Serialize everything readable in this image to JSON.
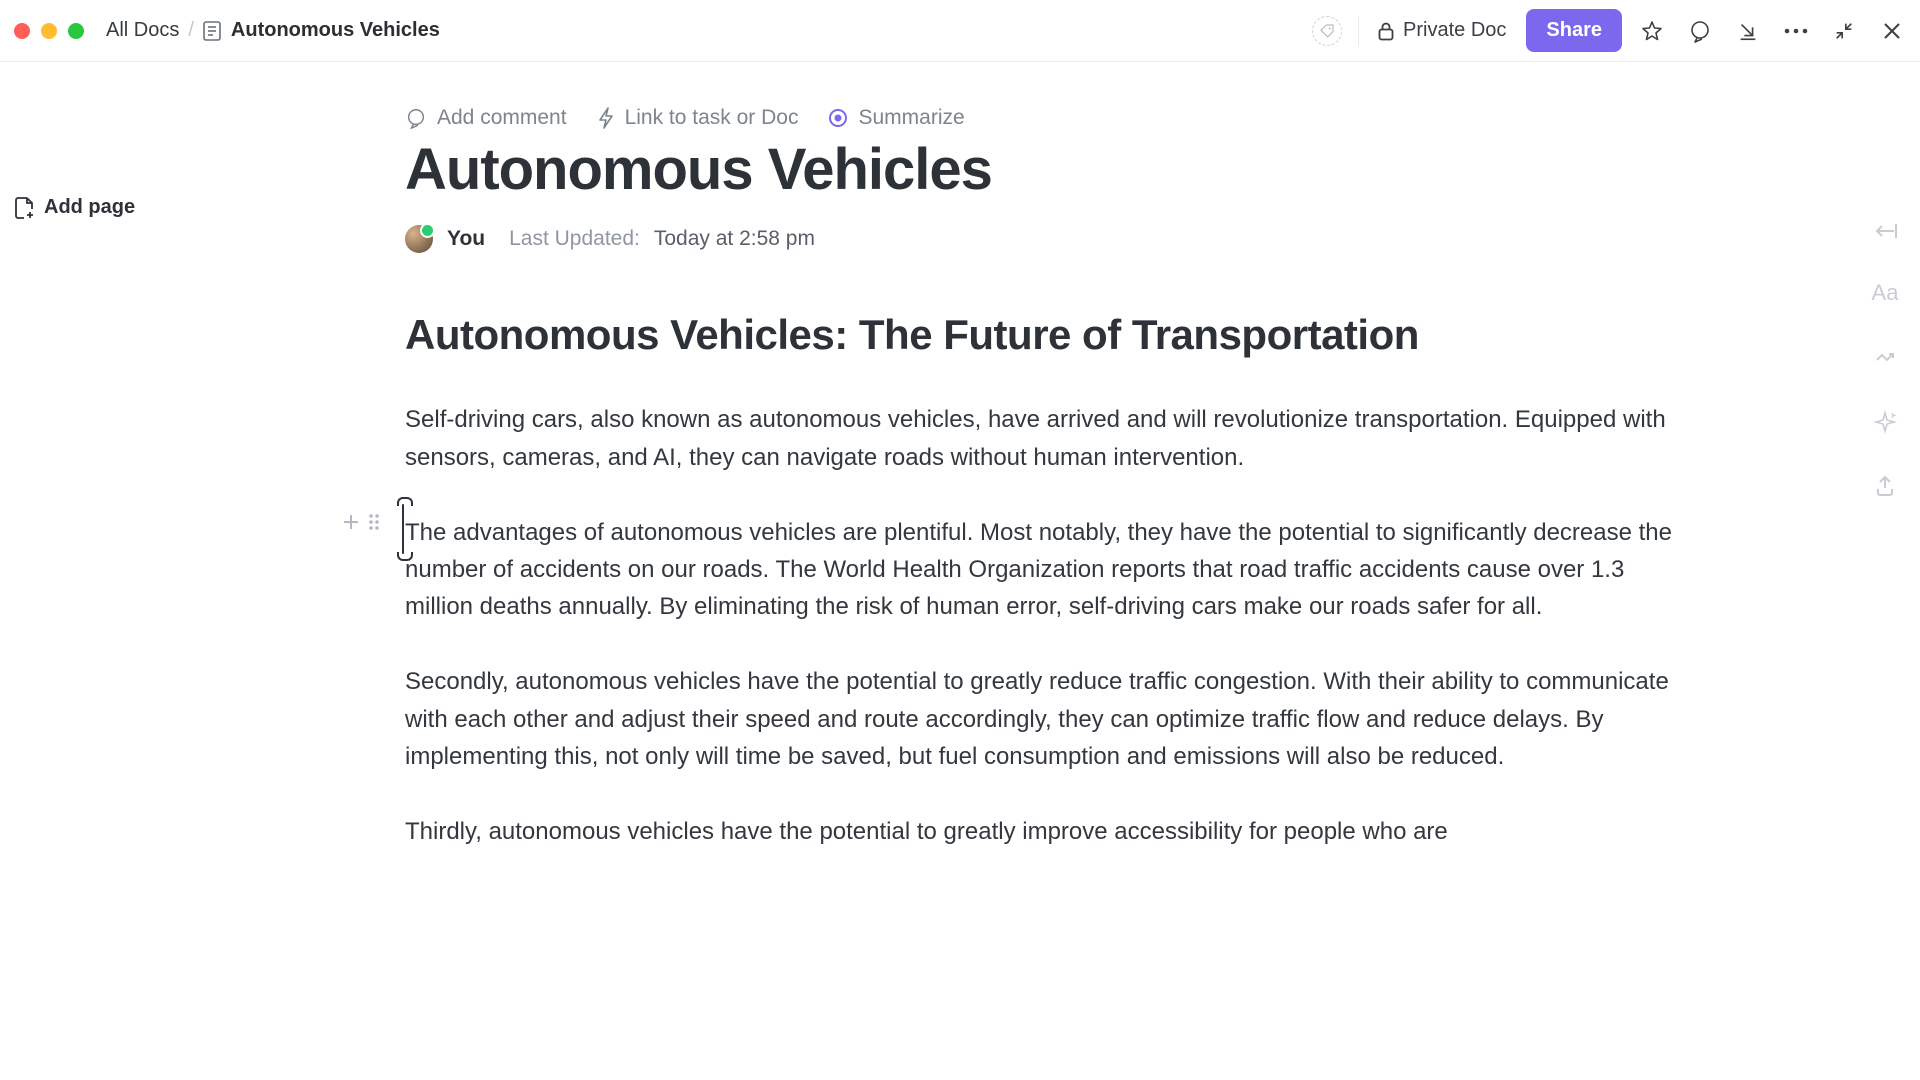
{
  "topbar": {
    "breadcrumb_root": "All Docs",
    "breadcrumb_current": "Autonomous Vehicles",
    "private_label": "Private Doc",
    "share_label": "Share"
  },
  "sidebar": {
    "add_page_label": "Add page"
  },
  "actions": {
    "add_comment": "Add comment",
    "link_task": "Link to task or Doc",
    "summarize": "Summarize"
  },
  "doc": {
    "title": "Autonomous Vehicles",
    "author": "You",
    "last_updated_label": "Last Updated:",
    "last_updated_value": "Today at 2:58 pm",
    "heading": "Autonomous Vehicles: The Future of Transportation",
    "p1": "Self-driving cars, also known as autonomous vehicles, have arrived and will revolutionize transportation. Equipped with sensors, cameras, and AI, they can navigate roads without human intervention.",
    "p2": "The advantages of autonomous vehicles are plentiful. Most notably, they have the potential to significantly decrease the number of accidents on our roads. The World Health Organization reports that road traffic accidents cause over 1.3 million deaths annually. By eliminating the risk of human error, self-driving cars make our roads safer for all.",
    "p3": "Secondly, autonomous vehicles have the potential to greatly reduce traffic congestion. With their ability to communicate with each other and adjust their speed and route accordingly, they can optimize traffic flow and reduce delays. By implementing this, not only will time be saved, but fuel consumption and emissions will also be reduced.",
    "p4": "Thirdly, autonomous vehicles have the potential to greatly improve accessibility for people who are"
  }
}
